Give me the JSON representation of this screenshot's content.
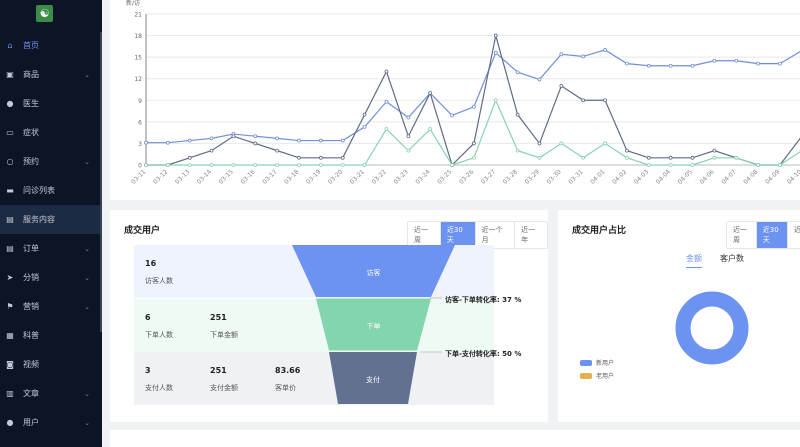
{
  "sidebar": {
    "items": [
      {
        "label": "首页",
        "icon": "home-icon",
        "active": true
      },
      {
        "label": "商品",
        "icon": "bag-icon",
        "chevron": true
      },
      {
        "label": "医生",
        "icon": "user-icon"
      },
      {
        "label": "症状",
        "icon": "book-icon"
      },
      {
        "label": "预约",
        "icon": "person-icon",
        "chevron": true
      },
      {
        "label": "问诊列表",
        "icon": "briefcase-icon"
      },
      {
        "label": "服务内容",
        "icon": "clipboard-icon",
        "selected": true
      },
      {
        "label": "订单",
        "icon": "clipboard-icon",
        "chevron": true
      },
      {
        "label": "分销",
        "icon": "send-icon",
        "chevron": true
      },
      {
        "label": "营销",
        "icon": "flag-icon",
        "chevron": true
      },
      {
        "label": "科普",
        "icon": "ticket-icon"
      },
      {
        "label": "视频",
        "icon": "camera-icon"
      },
      {
        "label": "文章",
        "icon": "library-icon",
        "chevron": true
      },
      {
        "label": "用户",
        "icon": "user-icon",
        "chevron": true
      }
    ]
  },
  "chart_data": {
    "type": "line",
    "ylabel": "新/访",
    "ylim": [
      0,
      21
    ],
    "yticks": [
      0,
      3,
      6,
      9,
      12,
      15,
      18,
      21
    ],
    "grid": true,
    "categories": [
      "03-11",
      "03-12",
      "03-13",
      "03-14",
      "03-15",
      "03-16",
      "03-17",
      "03-18",
      "03-19",
      "03-20",
      "03-21",
      "03-22",
      "03-23",
      "03-24",
      "03-25",
      "03-26",
      "03-27",
      "03-28",
      "03-29",
      "03-30",
      "03-31",
      "04-01",
      "04-02",
      "04-03",
      "04-04",
      "04-05",
      "04-06",
      "04-07",
      "04-08",
      "04-09",
      "04-10"
    ],
    "series": [
      {
        "color": "#6f8fd6",
        "values": [
          3.1,
          3.1,
          3.4,
          3.7,
          4.3,
          4.0,
          3.7,
          3.4,
          3.4,
          3.4,
          5.3,
          8.8,
          6.6,
          10,
          6.9,
          8.1,
          15.6,
          12.9,
          11.9,
          15.4,
          15.1,
          16,
          14.1,
          13.8,
          13.8,
          13.8,
          14.5,
          14.5,
          14.1,
          14.1,
          15.9
        ]
      },
      {
        "color": "#5f6b85",
        "values": [
          0,
          0,
          1,
          2,
          4,
          3,
          2,
          1,
          1,
          1,
          7,
          13,
          4,
          10,
          0,
          3,
          18,
          7,
          3,
          11,
          9,
          9,
          2,
          1,
          1,
          1,
          2,
          1,
          0,
          0,
          4
        ]
      },
      {
        "color": "#86d3ae",
        "values": [
          0,
          0,
          0,
          0,
          0,
          0,
          0,
          0,
          0,
          0,
          0,
          5,
          2,
          5,
          0,
          1,
          9,
          2,
          1,
          3,
          1,
          3,
          1,
          0,
          0,
          0,
          1,
          1,
          0,
          0,
          2
        ]
      }
    ]
  },
  "funnel": {
    "title": "成交用户",
    "ranges": [
      "近一周",
      "近30天",
      "近一个月",
      "近一年"
    ],
    "active_range": 1,
    "rows": [
      {
        "stats": [
          {
            "value": "16",
            "label": "访客人数"
          }
        ],
        "stage": "访客",
        "color": "#6b93ef",
        "bg": "#eef3fd"
      },
      {
        "stats": [
          {
            "value": "6",
            "label": "下单人数"
          },
          {
            "value": "251",
            "label": "下单金额"
          }
        ],
        "stage": "下单",
        "color": "#82d5ac",
        "bg": "#eefaf4"
      },
      {
        "stats": [
          {
            "value": "3",
            "label": "支付人数"
          },
          {
            "value": "251",
            "label": "支付金额"
          },
          {
            "value": "83.66",
            "label": "客单价"
          }
        ],
        "stage": "支付",
        "color": "#637190",
        "bg": "#f0f1f5"
      }
    ],
    "conversions": [
      "访客-下单转化率:  37 %",
      "下单-支付转化率:  50 %"
    ]
  },
  "pie": {
    "title": "成交用户占比",
    "ranges": [
      "近一周",
      "近30天",
      "近"
    ],
    "active_range": 1,
    "tabs": [
      "金额",
      "客户数"
    ],
    "active_tab": 0,
    "legend": [
      {
        "label": "新用户",
        "color": "#6b93ef"
      },
      {
        "label": "老用户",
        "color": "#e8b04a"
      }
    ],
    "values": [
      100,
      0
    ]
  }
}
